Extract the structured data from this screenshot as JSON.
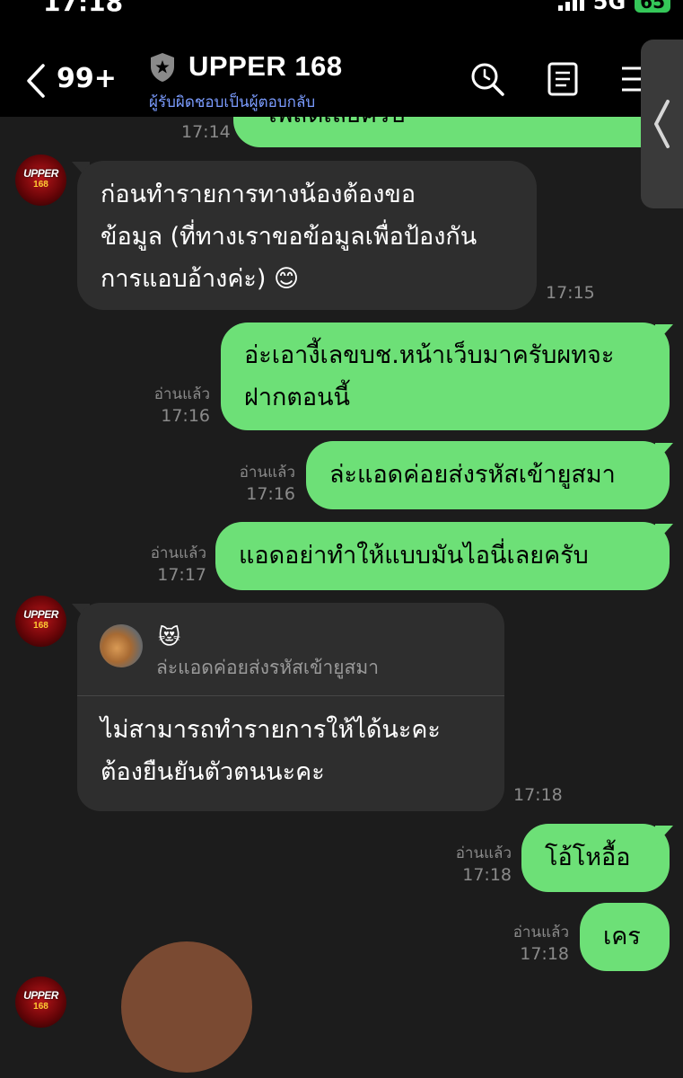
{
  "status": {
    "time": "17:18",
    "network": "5G",
    "battery": "65"
  },
  "header": {
    "back_count": "99+",
    "title": "UPPER 168",
    "subtitle": "ผู้รับผิดชอบเป็นผู้ตอบกลับ"
  },
  "avatar": {
    "brand": "UPPER",
    "num": "168"
  },
  "messages": {
    "m0": {
      "text": "โพสต์เลยครับ",
      "time": "17:14"
    },
    "m1": {
      "line1": "ก่อนทำรายการทางน้องต้องขอ",
      "line2": "ข้อมูล (ที่ทางเราขอข้อมูลเพื่อป้องกัน",
      "line3": "การแอบอ้างค่ะ) 😊",
      "time": "17:15"
    },
    "m2": {
      "line1": "อ่ะเอางี้เลขบช.หน้าเว็บมาครับผทจะ",
      "line2": "ฝากตอนนี้",
      "read": "อ่านแล้ว",
      "time": "17:16"
    },
    "m3": {
      "text": "ล่ะแอดค่อยส่งรหัสเข้ายูสมา",
      "read": "อ่านแล้ว",
      "time": "17:16"
    },
    "m4": {
      "text": "แอดอย่าทำให้แบบมันไอนี่เลยครับ",
      "read": "อ่านแล้ว",
      "time": "17:17"
    },
    "m5": {
      "reply_emoji": "😻",
      "reply_quote": "ล่ะแอดค่อยส่งรหัสเข้ายูสมา",
      "line1": "ไม่สามารถทำรายการให้ได้นะคะ",
      "line2": "ต้องยืนยันตัวตนนะคะ",
      "time": "17:18"
    },
    "m6": {
      "text": "โอ้โหอื้อ",
      "read": "อ่านแล้ว",
      "time": "17:18"
    },
    "m7": {
      "text": "เคร",
      "read": "อ่านแล้ว",
      "time": "17:18"
    }
  }
}
